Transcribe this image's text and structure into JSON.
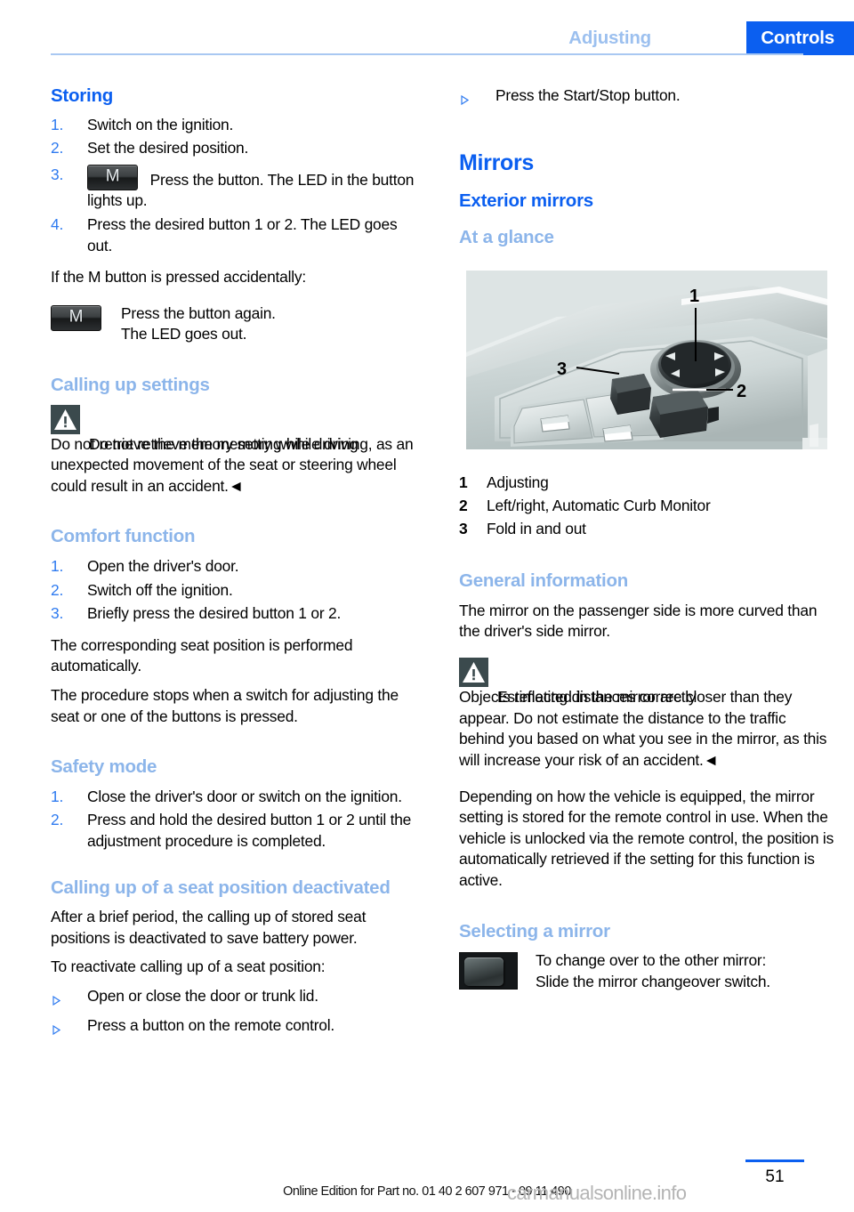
{
  "header": {
    "previous_section": "Adjusting",
    "current_section": "Controls"
  },
  "left_column": {
    "storing": {
      "heading": "Storing",
      "steps": [
        {
          "num": "1.",
          "text": "Switch on the ignition."
        },
        {
          "num": "2.",
          "text": "Set the desired position."
        },
        {
          "num": "3.",
          "icon": "m-button-icon",
          "text": "Press the button. The LED in the button lights up."
        },
        {
          "num": "4.",
          "text": "Press the desired button 1 or 2. The LED goes out."
        }
      ],
      "accidental_intro": "If the M button is pressed accidentally:",
      "accidental_icon": "m-button-icon",
      "accidental_line1": "Press the button again.",
      "accidental_line2": "The LED goes out."
    },
    "calling_up_settings": {
      "heading": "Calling up settings",
      "warning_icon": "warning-triangle-icon",
      "warning_title": "Do not retrieve the memory while driving",
      "warning_body": "Do not retrieve the memory setting while driving, as an unexpected movement of the seat or steering wheel could result in an accident.◄"
    },
    "comfort_function": {
      "heading": "Comfort function",
      "steps": [
        {
          "num": "1.",
          "text": "Open the driver's door."
        },
        {
          "num": "2.",
          "text": "Switch off the ignition."
        },
        {
          "num": "3.",
          "text": "Briefly press the desired button 1 or 2."
        }
      ],
      "para1": "The corresponding seat position is performed automatically.",
      "para2": "The procedure stops when a switch for adjusting the seat or one of the buttons is pressed."
    },
    "safety_mode": {
      "heading": "Safety mode",
      "steps": [
        {
          "num": "1.",
          "text": "Close the driver's door or switch on the ignition."
        },
        {
          "num": "2.",
          "text": "Press and hold the desired button 1 or 2 until the adjustment procedure is completed."
        }
      ]
    },
    "calling_up_deactivated": {
      "heading": "Calling up of a seat position deactivated",
      "para1": "After a brief period, the calling up of stored seat positions is deactivated to save battery power.",
      "para2": "To reactivate calling up of a seat position:",
      "bullets": [
        "Open or close the door or trunk lid.",
        "Press a button on the remote control."
      ]
    }
  },
  "right_column": {
    "top_bullet": "Press the Start/Stop button.",
    "mirrors": {
      "title": "Mirrors",
      "exterior_heading": "Exterior mirrors",
      "at_a_glance_heading": "At a glance",
      "illustration": {
        "name": "door-control-panel-illustration",
        "callouts": [
          "1",
          "2",
          "3"
        ]
      },
      "key_items": [
        {
          "num": "1",
          "label": "Adjusting"
        },
        {
          "num": "2",
          "label": "Left/right, Automatic Curb Monitor"
        },
        {
          "num": "3",
          "label": "Fold in and out"
        }
      ],
      "general_information": {
        "heading": "General information",
        "para1": "The mirror on the passenger side is more curved than the driver's side mirror.",
        "warning_icon": "warning-triangle-icon",
        "warning_title": "Estimating distances correctly",
        "warning_body": "Objects reflected in the mirror are closer than they appear. Do not estimate the distance to the traffic behind you based on what you see in the mirror, as this will increase your risk of an accident.◄",
        "para2": "Depending on how the vehicle is equipped, the mirror setting is stored for the remote control in use. When the vehicle is unlocked via the remote control, the position is automatically retrieved if the setting for this function is active."
      },
      "selecting_a_mirror": {
        "heading": "Selecting a mirror",
        "icon": "mirror-changeover-switch-icon",
        "line1": "To change over to the other mirror:",
        "line2": "Slide the mirror changeover switch."
      }
    }
  },
  "footer": {
    "page_number": "51",
    "edition_line": "Online Edition for Part no. 01 40 2 607 971 - 09 11 490",
    "watermark": "carmanualsonline.info"
  },
  "colors": {
    "accent_blue": "#0b5ff0",
    "light_blue": "#8cb5ea",
    "rule_blue": "#a9c8f2"
  }
}
